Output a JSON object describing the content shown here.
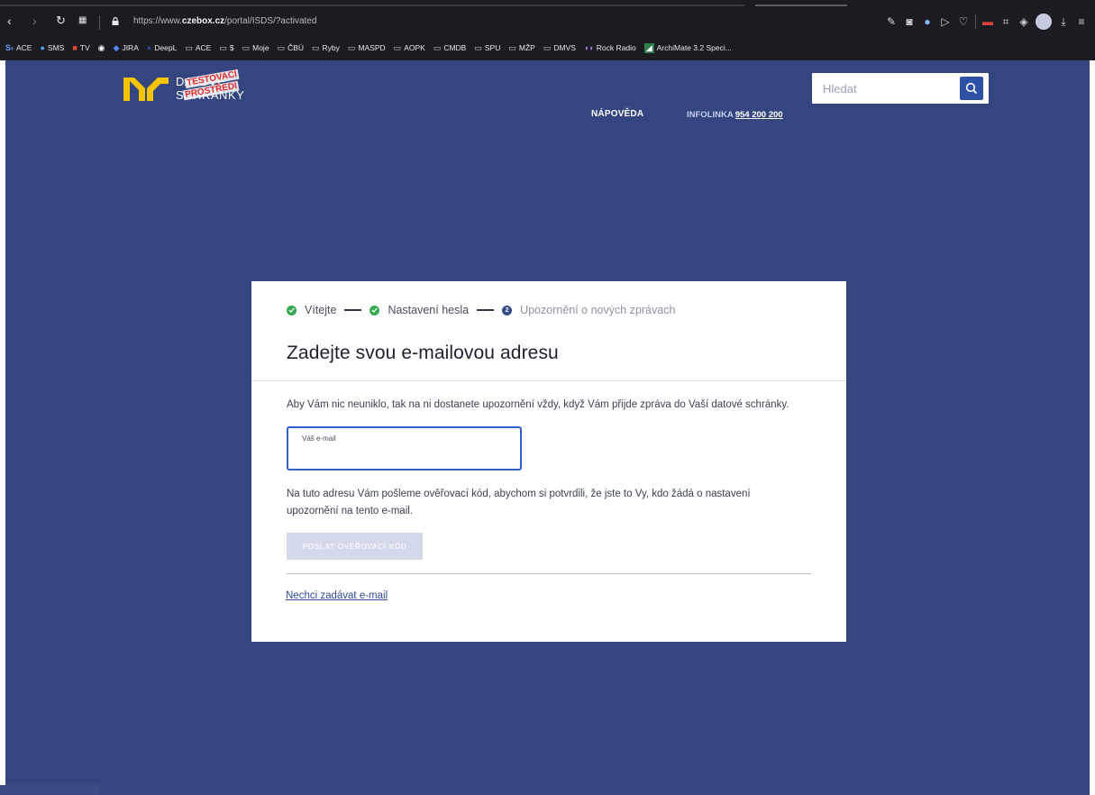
{
  "browser": {
    "url_prefix": "https://www.",
    "url_domain": "czebox.cz",
    "url_path": "/portal/ISDS/?activated",
    "bookmarks": [
      {
        "label": "ACE",
        "icon": "s-icon"
      },
      {
        "label": "SMS",
        "icon": "chat-icon"
      },
      {
        "label": "TV",
        "icon": "tv-icon"
      },
      {
        "label": "",
        "icon": "circle-icon"
      },
      {
        "label": "JIRA",
        "icon": "jira-icon"
      },
      {
        "label": "DeepL",
        "icon": "deepl-icon"
      },
      {
        "label": "ACE",
        "icon": "folder-icon"
      },
      {
        "label": "$",
        "icon": "folder-icon"
      },
      {
        "label": "Moje",
        "icon": "folder-icon"
      },
      {
        "label": "ČBÚ",
        "icon": "folder-icon"
      },
      {
        "label": "Ryby",
        "icon": "folder-icon"
      },
      {
        "label": "MASPD",
        "icon": "folder-icon"
      },
      {
        "label": "AOPK",
        "icon": "folder-icon"
      },
      {
        "label": "CMDB",
        "icon": "folder-icon"
      },
      {
        "label": "SPU",
        "icon": "folder-icon"
      },
      {
        "label": "MŽP",
        "icon": "folder-icon"
      },
      {
        "label": "DMVS",
        "icon": "folder-icon"
      },
      {
        "label": "Rock Radio",
        "icon": "radio-icon"
      },
      {
        "label": "ArchiMate 3.2 Speci...",
        "icon": "archimate-icon"
      }
    ]
  },
  "header": {
    "logo_line1": "DATOVÉ",
    "logo_line2": "SCHRÁNKY",
    "logo_stamp1": "TESTOVACÍ",
    "logo_stamp2": "PROSTŘEDÍ",
    "help_label": "NÁPOVĚDA",
    "infoline_label": "INFOLINKA",
    "infoline_number": "954 200 200",
    "search_placeholder": "Hledat"
  },
  "wizard": {
    "steps": [
      {
        "label": "Vítejte",
        "state": "done"
      },
      {
        "label": "Nastavení hesla",
        "state": "done"
      },
      {
        "label": "Upozornění o nových zprávach",
        "state": "current",
        "number": "2"
      }
    ],
    "title": "Zadejte svou e-mailovou adresu",
    "intro": "Aby Vám nic neuniklo, tak na ni dostanete upozornění vždy, když Vám přijde zpráva do Vaší datové schránky.",
    "email_label": "Váš e-mail",
    "email_value": "",
    "explanation": "Na tuto adresu Vám pošleme ověřovací kód, abychom si potvrdili, že jste to Vy, kdo žádá o nastavení upozornění na tento e-mail.",
    "send_button": "POSLAT OVĚŘOVACÍ KÓD",
    "skip_link": "Nechci zadávat e-mail"
  },
  "colors": {
    "page_background": "#35457f",
    "accent_yellow": "#f5c400",
    "step_done": "#34a853",
    "step_current": "#354a86",
    "field_focus": "#3160c8"
  }
}
